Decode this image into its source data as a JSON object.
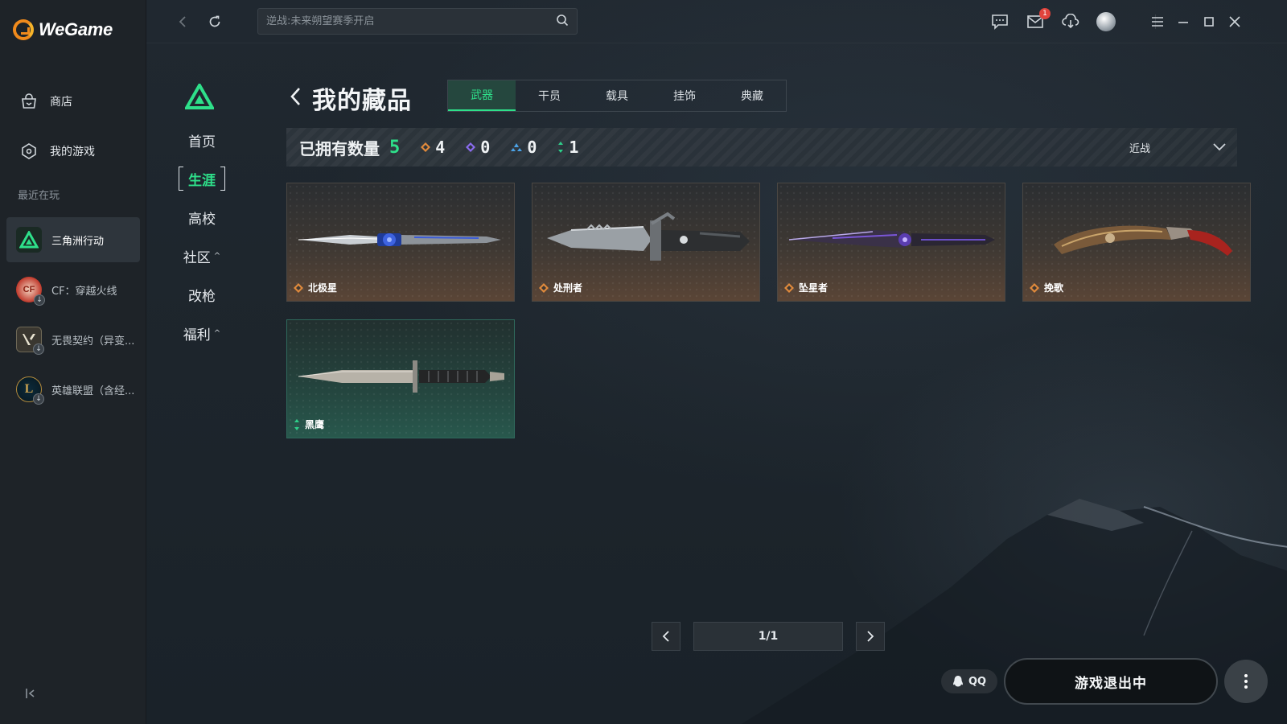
{
  "app": {
    "name": "WeGame"
  },
  "sidebar": {
    "nav": [
      {
        "label": "商店",
        "icon": "store-icon"
      },
      {
        "label": "我的游戏",
        "icon": "my-games-icon"
      }
    ],
    "recent_label": "最近在玩",
    "recent_games": [
      {
        "label": "三角洲行动",
        "icon": "delta-force-icon",
        "active": true
      },
      {
        "label": "CF：穿越火线",
        "icon": "crossfire-icon"
      },
      {
        "label": "无畏契约（异变...",
        "icon": "valorant-icon"
      },
      {
        "label": "英雄联盟（含经...",
        "icon": "lol-icon"
      }
    ]
  },
  "topbar": {
    "search_placeholder": "逆战:未来朔望赛季开启",
    "mail_badge": "1"
  },
  "game_nav": {
    "items": [
      {
        "label": "首页"
      },
      {
        "label": "生涯",
        "active": true
      },
      {
        "label": "高校"
      },
      {
        "label": "社区",
        "caret": "^"
      },
      {
        "label": "改枪"
      },
      {
        "label": "福利",
        "caret": "^"
      }
    ]
  },
  "page": {
    "title": "我的藏品",
    "tabs": [
      {
        "label": "武器",
        "active": true
      },
      {
        "label": "干员"
      },
      {
        "label": "载具"
      },
      {
        "label": "挂饰"
      },
      {
        "label": "典藏"
      }
    ]
  },
  "stats": {
    "owned_label": "已拥有数量",
    "owned_total": "5",
    "rarities": [
      {
        "value": "4",
        "color": "#e08a3c",
        "icon": "orange-rarity-icon"
      },
      {
        "value": "0",
        "color": "#8b6cf0",
        "icon": "purple-rarity-icon"
      },
      {
        "value": "0",
        "color": "#4aa3e8",
        "icon": "blue-rarity-icon"
      },
      {
        "value": "1",
        "color": "#2ed08a",
        "icon": "green-rarity-icon"
      }
    ],
    "filter_value": "近战"
  },
  "items": [
    {
      "name": "北极星",
      "rarity": "orange",
      "weapon": "knife-polaris"
    },
    {
      "name": "处刑者",
      "rarity": "orange",
      "weapon": "knife-executioner"
    },
    {
      "name": "坠星者",
      "rarity": "orange",
      "weapon": "knife-starfall"
    },
    {
      "name": "挽歌",
      "rarity": "orange",
      "weapon": "knife-elegy"
    },
    {
      "name": "黑鹰",
      "rarity": "green",
      "weapon": "knife-blackhawk"
    }
  ],
  "pagination": {
    "page_text": "1/1"
  },
  "bottom": {
    "qq_label": "QQ",
    "launch_label": "游戏退出中"
  },
  "colors": {
    "accent_green": "#2ee08a",
    "brand_orange": "#f08a1c"
  }
}
